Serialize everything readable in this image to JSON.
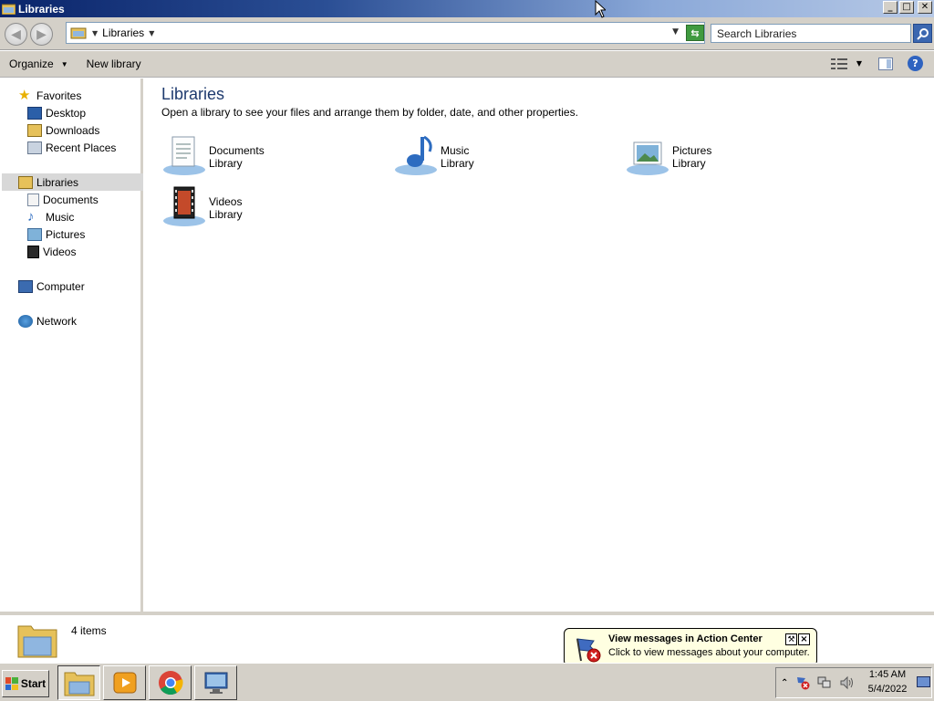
{
  "window": {
    "title": "Libraries",
    "buttons": {
      "minimize": "_",
      "maximize": "□",
      "close": "✕"
    }
  },
  "address": {
    "crumb": "Libraries",
    "search_placeholder": "Search Libraries"
  },
  "commands": {
    "organize": "Organize",
    "new_library": "New library"
  },
  "nav": {
    "favorites": "Favorites",
    "favorites_items": [
      "Desktop",
      "Downloads",
      "Recent Places"
    ],
    "libraries": "Libraries",
    "libraries_items": [
      "Documents",
      "Music",
      "Pictures",
      "Videos"
    ],
    "computer": "Computer",
    "network": "Network"
  },
  "main": {
    "heading": "Libraries",
    "subtitle": "Open a library to see your files and arrange them by folder, date, and other properties.",
    "libraries": [
      {
        "name": "Documents",
        "type": "Library",
        "icon": "documents-library-icon"
      },
      {
        "name": "Music",
        "type": "Library",
        "icon": "music-library-icon"
      },
      {
        "name": "Pictures",
        "type": "Library",
        "icon": "pictures-library-icon"
      },
      {
        "name": "Videos",
        "type": "Library",
        "icon": "videos-library-icon"
      }
    ]
  },
  "details": {
    "count": "4 items"
  },
  "balloon": {
    "title": "View messages in Action Center",
    "text": "Click to view messages about your computer."
  },
  "taskbar": {
    "start": "Start",
    "apps": [
      "explorer-icon",
      "media-player-icon",
      "chrome-icon",
      "remote-desktop-icon"
    ],
    "time": "1:45 AM",
    "date": "5/4/2022"
  },
  "colors": {
    "title_gradient_start": "#0a246a",
    "heading": "#1e3a6e",
    "balloon_bg": "#ffffe1",
    "selection": "#d8d8d8"
  }
}
